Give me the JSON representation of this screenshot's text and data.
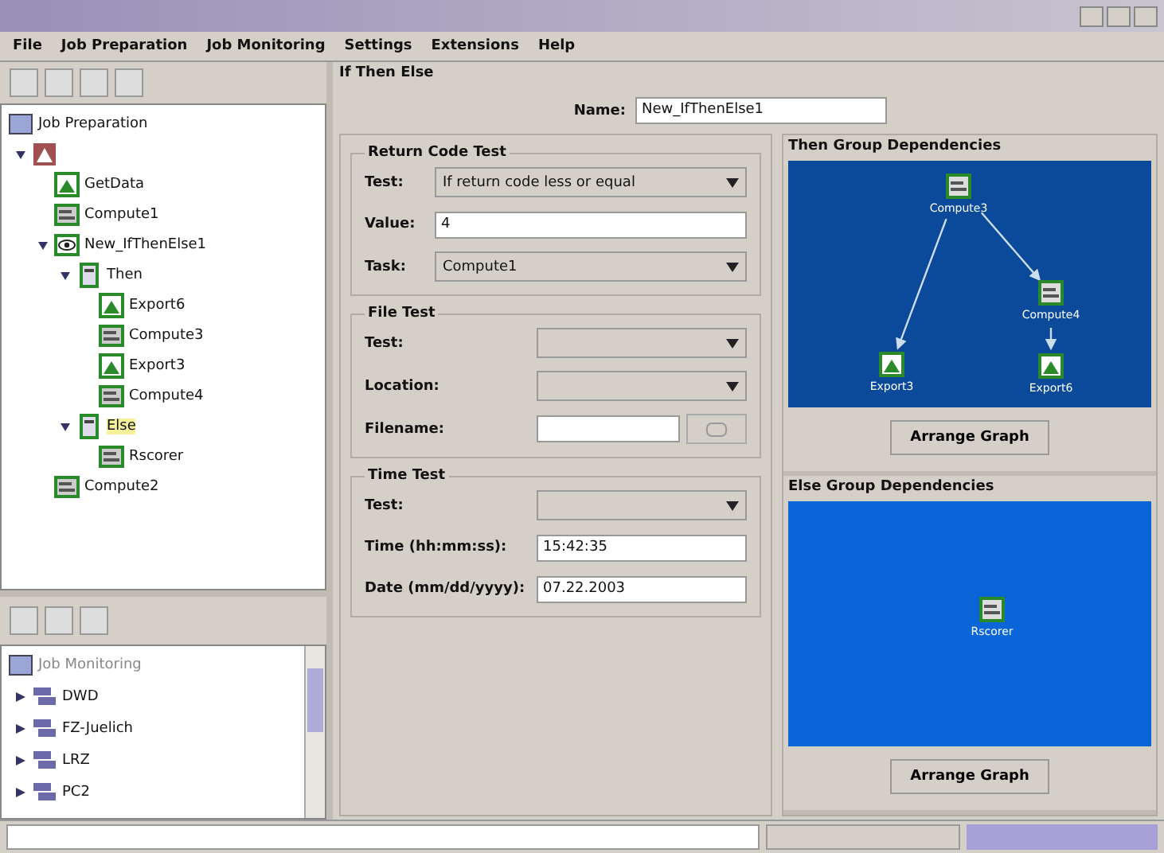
{
  "menu": [
    "File",
    "Job Preparation",
    "Job Monitoring",
    "Settings",
    "Extensions",
    "Help"
  ],
  "job_tree": {
    "title": "Job Preparation",
    "nodes": [
      {
        "kind": "group",
        "expanded": true,
        "children": [
          {
            "label": "GetData",
            "kind": "export",
            "highlighted": false
          },
          {
            "label": "Compute1",
            "kind": "compute",
            "highlighted": false
          },
          {
            "label": "New_IfThenElse1",
            "kind": "condition",
            "expanded": true,
            "highlighted": false,
            "children": [
              {
                "label": "Then",
                "kind": "branch",
                "expanded": true,
                "highlighted": false,
                "children": [
                  {
                    "label": "Export6",
                    "kind": "export",
                    "highlighted": false
                  },
                  {
                    "label": "Compute3",
                    "kind": "compute",
                    "highlighted": false
                  },
                  {
                    "label": "Export3",
                    "kind": "export",
                    "highlighted": false
                  },
                  {
                    "label": "Compute4",
                    "kind": "compute",
                    "highlighted": false
                  }
                ]
              },
              {
                "label": "Else",
                "kind": "branch",
                "expanded": true,
                "highlighted": true,
                "children": [
                  {
                    "label": "Rscorer",
                    "kind": "compute",
                    "highlighted": false
                  }
                ]
              }
            ]
          },
          {
            "label": "Compute2",
            "kind": "compute",
            "highlighted": false
          }
        ]
      }
    ]
  },
  "monitor_tree": {
    "title": "Job Monitoring",
    "nodes": [
      {
        "label": "DWD",
        "kind": "site",
        "expanded": false
      },
      {
        "label": "FZ-Juelich",
        "kind": "site",
        "expanded": false
      },
      {
        "label": "LRZ",
        "kind": "site",
        "expanded": false
      },
      {
        "label": "PC2",
        "kind": "site",
        "expanded": false
      }
    ]
  },
  "editor": {
    "title": "If Then Else",
    "name_label": "Name:",
    "name_value": "New_IfThenElse1"
  },
  "sections": [
    {
      "title": "Return Code Test",
      "fields": [
        {
          "label": "Test:",
          "kind": "dropdown",
          "value": "If return code less or equal"
        },
        {
          "label": "Value:",
          "kind": "text",
          "value": "4"
        },
        {
          "label": "Task:",
          "kind": "dropdown",
          "value": "Compute1"
        }
      ]
    },
    {
      "title": "File Test",
      "fields": [
        {
          "label": "Test:",
          "kind": "dropdown"
        },
        {
          "label": "Location:",
          "kind": "dropdown"
        },
        {
          "label": "Filename:",
          "kind": "file"
        }
      ]
    },
    {
      "title": "Time Test",
      "fields": [
        {
          "label": "Test:",
          "kind": "dropdown"
        },
        {
          "label": "Time (hh:mm:ss):",
          "kind": "text",
          "value": "15:42:35"
        },
        {
          "label": "Date (mm/dd/yyyy):",
          "kind": "text",
          "value": "07.22.2003"
        }
      ]
    }
  ],
  "graphs": [
    {
      "title": "Then Group Dependencies",
      "button": "Arrange Graph",
      "nodes": [
        {
          "label": "Compute3",
          "kind": "compute"
        },
        {
          "label": "Compute4",
          "kind": "compute"
        },
        {
          "label": "Export3",
          "kind": "export"
        },
        {
          "label": "Export6",
          "kind": "export"
        }
      ]
    },
    {
      "title": "Else Group Dependencies",
      "button": "Arrange Graph",
      "nodes": [
        {
          "label": "Rscorer",
          "kind": "compute"
        }
      ]
    }
  ]
}
